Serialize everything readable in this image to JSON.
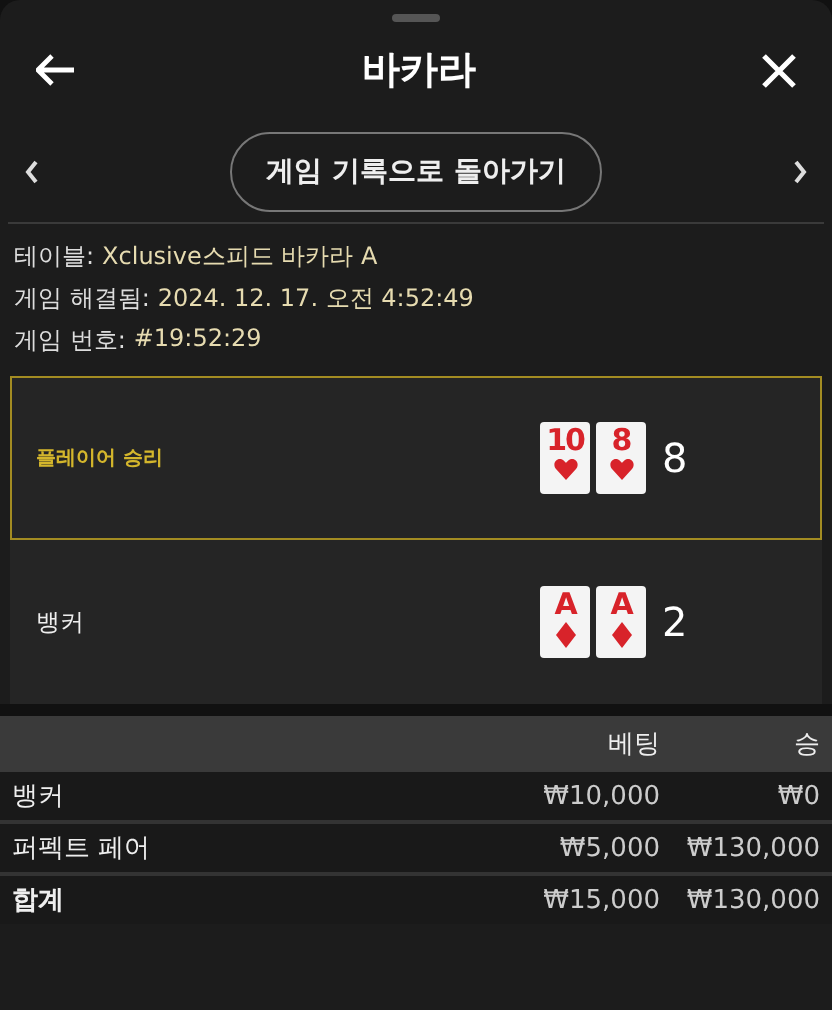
{
  "header": {
    "title": "바카라"
  },
  "nav": {
    "back_label": "게임 기록으로 돌아가기"
  },
  "info": [
    {
      "label": "테이블:",
      "value": "Xclusive스피드 바카라 A"
    },
    {
      "label": "게임 해결됨:",
      "value": "2024. 12. 17. 오전 4:52:49"
    },
    {
      "label": "게임 번호:",
      "value": "#19:52:29"
    }
  ],
  "hands": [
    {
      "name": "플레이어 승리",
      "winner": true,
      "cards": [
        {
          "rank": "10",
          "kind": "heart"
        },
        {
          "rank": "8",
          "kind": "heart"
        }
      ],
      "total": "8"
    },
    {
      "name": "뱅커",
      "winner": false,
      "cards": [
        {
          "rank": "A",
          "kind": "diamond"
        },
        {
          "rank": "A",
          "kind": "diamond"
        }
      ],
      "total": "2"
    }
  ],
  "table": {
    "columns": [
      "",
      "베팅",
      "승"
    ],
    "rows": [
      {
        "kind": "bet",
        "cells": [
          "뱅커",
          "₩10,000",
          "₩0"
        ]
      },
      {
        "kind": "bet",
        "cells": [
          "퍼펙트 페어",
          "₩5,000",
          "₩130,000"
        ]
      },
      {
        "kind": "total",
        "cells": [
          "합계",
          "₩15,000",
          "₩130,000"
        ]
      }
    ]
  }
}
